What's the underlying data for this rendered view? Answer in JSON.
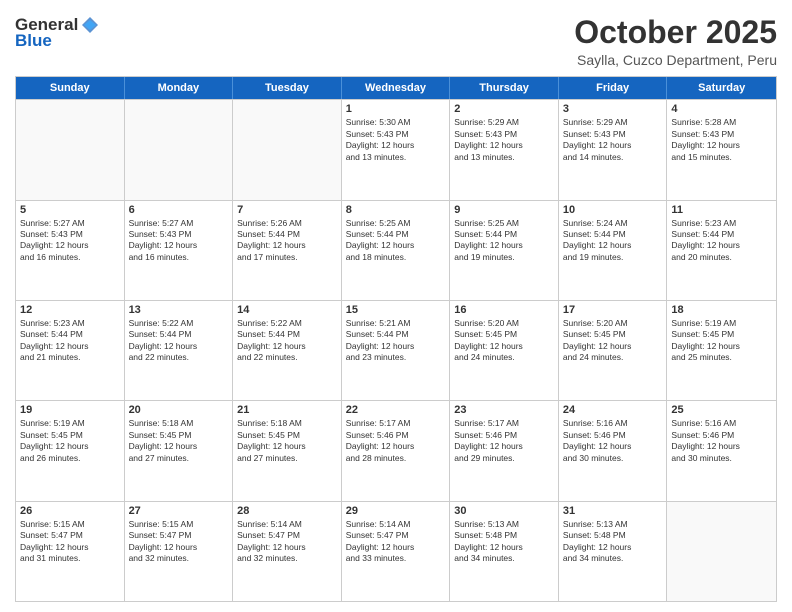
{
  "logo": {
    "general": "General",
    "blue": "Blue"
  },
  "header": {
    "month": "October 2025",
    "location": "Saylla, Cuzco Department, Peru"
  },
  "days": [
    "Sunday",
    "Monday",
    "Tuesday",
    "Wednesday",
    "Thursday",
    "Friday",
    "Saturday"
  ],
  "rows": [
    [
      {
        "day": "",
        "empty": true
      },
      {
        "day": "",
        "empty": true
      },
      {
        "day": "",
        "empty": true
      },
      {
        "day": "1",
        "lines": [
          "Sunrise: 5:30 AM",
          "Sunset: 5:43 PM",
          "Daylight: 12 hours",
          "and 13 minutes."
        ]
      },
      {
        "day": "2",
        "lines": [
          "Sunrise: 5:29 AM",
          "Sunset: 5:43 PM",
          "Daylight: 12 hours",
          "and 13 minutes."
        ]
      },
      {
        "day": "3",
        "lines": [
          "Sunrise: 5:29 AM",
          "Sunset: 5:43 PM",
          "Daylight: 12 hours",
          "and 14 minutes."
        ]
      },
      {
        "day": "4",
        "lines": [
          "Sunrise: 5:28 AM",
          "Sunset: 5:43 PM",
          "Daylight: 12 hours",
          "and 15 minutes."
        ]
      }
    ],
    [
      {
        "day": "5",
        "lines": [
          "Sunrise: 5:27 AM",
          "Sunset: 5:43 PM",
          "Daylight: 12 hours",
          "and 16 minutes."
        ]
      },
      {
        "day": "6",
        "lines": [
          "Sunrise: 5:27 AM",
          "Sunset: 5:43 PM",
          "Daylight: 12 hours",
          "and 16 minutes."
        ]
      },
      {
        "day": "7",
        "lines": [
          "Sunrise: 5:26 AM",
          "Sunset: 5:44 PM",
          "Daylight: 12 hours",
          "and 17 minutes."
        ]
      },
      {
        "day": "8",
        "lines": [
          "Sunrise: 5:25 AM",
          "Sunset: 5:44 PM",
          "Daylight: 12 hours",
          "and 18 minutes."
        ]
      },
      {
        "day": "9",
        "lines": [
          "Sunrise: 5:25 AM",
          "Sunset: 5:44 PM",
          "Daylight: 12 hours",
          "and 19 minutes."
        ]
      },
      {
        "day": "10",
        "lines": [
          "Sunrise: 5:24 AM",
          "Sunset: 5:44 PM",
          "Daylight: 12 hours",
          "and 19 minutes."
        ]
      },
      {
        "day": "11",
        "lines": [
          "Sunrise: 5:23 AM",
          "Sunset: 5:44 PM",
          "Daylight: 12 hours",
          "and 20 minutes."
        ]
      }
    ],
    [
      {
        "day": "12",
        "lines": [
          "Sunrise: 5:23 AM",
          "Sunset: 5:44 PM",
          "Daylight: 12 hours",
          "and 21 minutes."
        ]
      },
      {
        "day": "13",
        "lines": [
          "Sunrise: 5:22 AM",
          "Sunset: 5:44 PM",
          "Daylight: 12 hours",
          "and 22 minutes."
        ]
      },
      {
        "day": "14",
        "lines": [
          "Sunrise: 5:22 AM",
          "Sunset: 5:44 PM",
          "Daylight: 12 hours",
          "and 22 minutes."
        ]
      },
      {
        "day": "15",
        "lines": [
          "Sunrise: 5:21 AM",
          "Sunset: 5:44 PM",
          "Daylight: 12 hours",
          "and 23 minutes."
        ]
      },
      {
        "day": "16",
        "lines": [
          "Sunrise: 5:20 AM",
          "Sunset: 5:45 PM",
          "Daylight: 12 hours",
          "and 24 minutes."
        ]
      },
      {
        "day": "17",
        "lines": [
          "Sunrise: 5:20 AM",
          "Sunset: 5:45 PM",
          "Daylight: 12 hours",
          "and 24 minutes."
        ]
      },
      {
        "day": "18",
        "lines": [
          "Sunrise: 5:19 AM",
          "Sunset: 5:45 PM",
          "Daylight: 12 hours",
          "and 25 minutes."
        ]
      }
    ],
    [
      {
        "day": "19",
        "lines": [
          "Sunrise: 5:19 AM",
          "Sunset: 5:45 PM",
          "Daylight: 12 hours",
          "and 26 minutes."
        ]
      },
      {
        "day": "20",
        "lines": [
          "Sunrise: 5:18 AM",
          "Sunset: 5:45 PM",
          "Daylight: 12 hours",
          "and 27 minutes."
        ]
      },
      {
        "day": "21",
        "lines": [
          "Sunrise: 5:18 AM",
          "Sunset: 5:45 PM",
          "Daylight: 12 hours",
          "and 27 minutes."
        ]
      },
      {
        "day": "22",
        "lines": [
          "Sunrise: 5:17 AM",
          "Sunset: 5:46 PM",
          "Daylight: 12 hours",
          "and 28 minutes."
        ]
      },
      {
        "day": "23",
        "lines": [
          "Sunrise: 5:17 AM",
          "Sunset: 5:46 PM",
          "Daylight: 12 hours",
          "and 29 minutes."
        ]
      },
      {
        "day": "24",
        "lines": [
          "Sunrise: 5:16 AM",
          "Sunset: 5:46 PM",
          "Daylight: 12 hours",
          "and 30 minutes."
        ]
      },
      {
        "day": "25",
        "lines": [
          "Sunrise: 5:16 AM",
          "Sunset: 5:46 PM",
          "Daylight: 12 hours",
          "and 30 minutes."
        ]
      }
    ],
    [
      {
        "day": "26",
        "lines": [
          "Sunrise: 5:15 AM",
          "Sunset: 5:47 PM",
          "Daylight: 12 hours",
          "and 31 minutes."
        ]
      },
      {
        "day": "27",
        "lines": [
          "Sunrise: 5:15 AM",
          "Sunset: 5:47 PM",
          "Daylight: 12 hours",
          "and 32 minutes."
        ]
      },
      {
        "day": "28",
        "lines": [
          "Sunrise: 5:14 AM",
          "Sunset: 5:47 PM",
          "Daylight: 12 hours",
          "and 32 minutes."
        ]
      },
      {
        "day": "29",
        "lines": [
          "Sunrise: 5:14 AM",
          "Sunset: 5:47 PM",
          "Daylight: 12 hours",
          "and 33 minutes."
        ]
      },
      {
        "day": "30",
        "lines": [
          "Sunrise: 5:13 AM",
          "Sunset: 5:48 PM",
          "Daylight: 12 hours",
          "and 34 minutes."
        ]
      },
      {
        "day": "31",
        "lines": [
          "Sunrise: 5:13 AM",
          "Sunset: 5:48 PM",
          "Daylight: 12 hours",
          "and 34 minutes."
        ]
      },
      {
        "day": "",
        "empty": true
      }
    ]
  ]
}
